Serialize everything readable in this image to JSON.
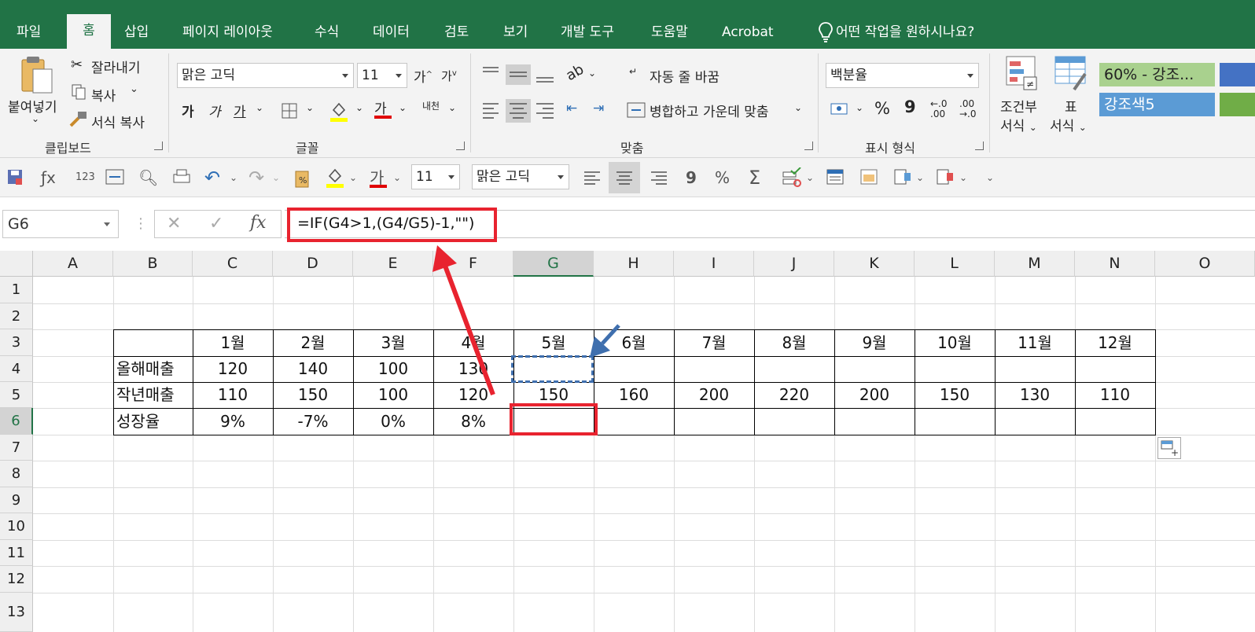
{
  "tabs": [
    {
      "label": "파일",
      "active": false
    },
    {
      "label": "홈",
      "active": true
    },
    {
      "label": "삽입",
      "active": false
    },
    {
      "label": "페이지 레이아웃",
      "active": false
    },
    {
      "label": "수식",
      "active": false
    },
    {
      "label": "데이터",
      "active": false
    },
    {
      "label": "검토",
      "active": false
    },
    {
      "label": "보기",
      "active": false
    },
    {
      "label": "개발 도구",
      "active": false
    },
    {
      "label": "도움말",
      "active": false
    },
    {
      "label": "Acrobat",
      "active": false
    }
  ],
  "tell_me": "어떤 작업을 원하시나요?",
  "clipboard": {
    "paste": "붙여넣기",
    "cut": "잘라내기",
    "copy": "복사",
    "format_painter": "서식 복사",
    "group": "클립보드"
  },
  "font": {
    "name": "맑은 고딕",
    "size": "11",
    "grow": "가",
    "shrink": "가",
    "bold": "가",
    "italic": "가",
    "underline": "가",
    "font_color": "가",
    "phonetic": "내천",
    "group": "글꼴"
  },
  "alignment": {
    "wrap": "자동 줄 바꿈",
    "merge": "병합하고 가운데 맞춤",
    "group": "맞춤"
  },
  "number": {
    "format": "백분율",
    "percent": "%",
    "comma": "9",
    "increase_decimal": "←.0 .00",
    "decrease_decimal": ".00 →.0",
    "group": "표시 형식"
  },
  "styles": {
    "conditional": "조건부",
    "conditional2": "서식",
    "table": "표",
    "table2": "서식",
    "style1": "60% - 강조...",
    "style2": "강조색5",
    "style1_color": "#a9d18e",
    "style2_color": "#5b9bd5"
  },
  "qat": {
    "font_size": "11",
    "font_name": "맑은 고딕",
    "font_color_letter": "가",
    "comma": "9",
    "percent": "%",
    "sum": "Σ"
  },
  "formula_bar": {
    "name_box": "G6",
    "formula": "=IF(G4>1,(G4/G5)-1,\"\")",
    "cancel": "✕",
    "enter": "✓",
    "fx": "fx"
  },
  "columns": [
    "A",
    "B",
    "C",
    "D",
    "E",
    "F",
    "G",
    "H",
    "I",
    "J",
    "K",
    "L",
    "M",
    "N",
    "O"
  ],
  "rows": [
    "1",
    "2",
    "3",
    "4",
    "5",
    "6",
    "7",
    "8",
    "9",
    "10",
    "11",
    "12",
    "13"
  ],
  "selected_column": "G",
  "selected_row": "6",
  "table": {
    "header": [
      "",
      "1월",
      "2월",
      "3월",
      "4월",
      "5월",
      "6월",
      "7월",
      "8월",
      "9월",
      "10월",
      "11월",
      "12월"
    ],
    "rows": [
      [
        "올해매출",
        "120",
        "140",
        "100",
        "130",
        "",
        "",
        "",
        "",
        "",
        "",
        "",
        ""
      ],
      [
        "작년매출",
        "110",
        "150",
        "100",
        "120",
        "150",
        "160",
        "200",
        "220",
        "200",
        "150",
        "130",
        "110"
      ],
      [
        "성장율",
        "9%",
        "-7%",
        "0%",
        "8%",
        "",
        "",
        "",
        "",
        "",
        "",
        "",
        ""
      ]
    ]
  },
  "annotation_color": "#e8232f",
  "pointer_color": "#3f6fae"
}
